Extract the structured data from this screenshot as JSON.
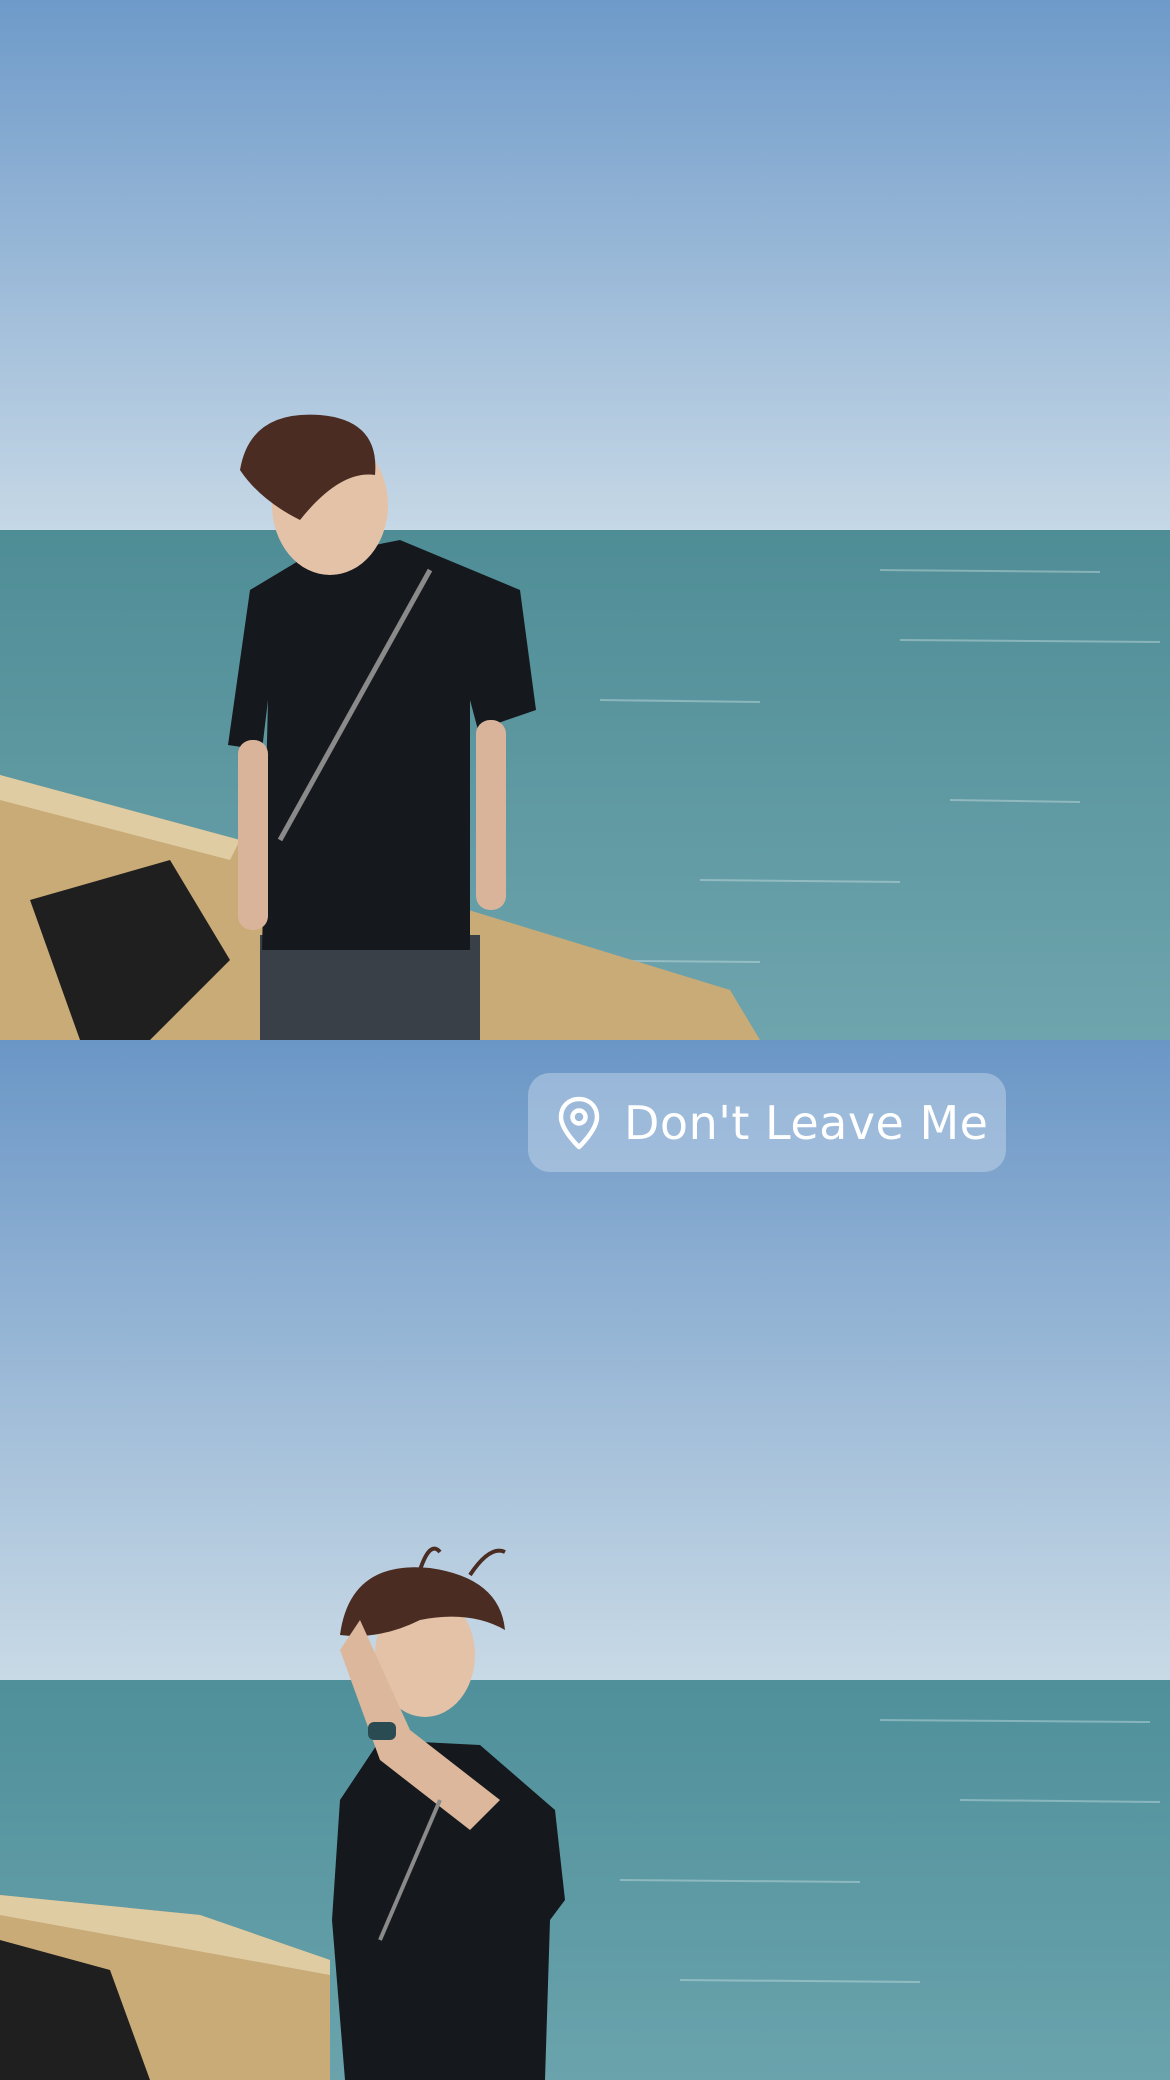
{
  "location_sticker": {
    "icon": "location-pin-icon",
    "label": "Don't Leave Me"
  },
  "colors": {
    "sky_top": "#6e9ac9",
    "sky_bottom": "#c3d6e6",
    "sea": "#5f9aa3",
    "shirt": "#15191d",
    "hair": "#4a2c22",
    "wall_light": "#c9ab78",
    "wall_dark": "#1f1f1f"
  }
}
